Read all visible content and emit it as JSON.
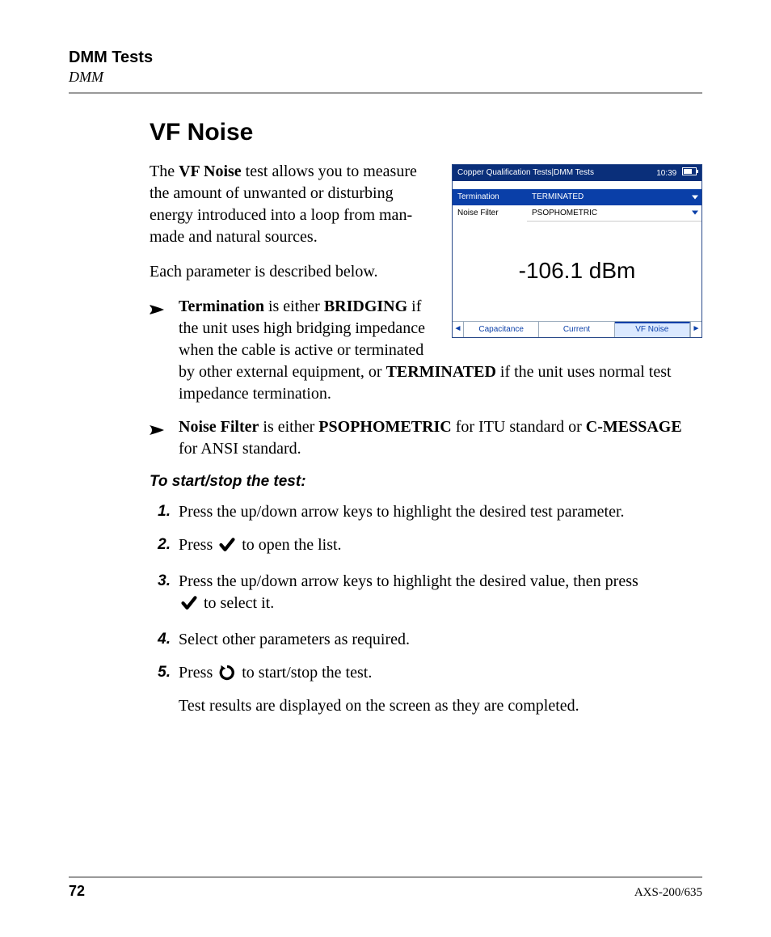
{
  "header": {
    "chapter": "DMM Tests",
    "section": "DMM"
  },
  "title": "VF Noise",
  "intro": {
    "p1_a": "The ",
    "p1_b": "VF Noise",
    "p1_c": " test allows you to measure the amount of unwanted or disturbing energy introduced into a loop from man-made and natural sources.",
    "p2": "Each parameter is described below."
  },
  "bullets": {
    "b1": {
      "t1": "Termination",
      "t2": " is either ",
      "t3": "BRIDGING",
      "t4": " if the unit uses high bridging impedance when the cable is active or terminated by other external equipment, or ",
      "t5": "TERMINATED",
      "t6": " if the unit uses normal test impedance termination."
    },
    "b2": {
      "t1": "Noise Filter",
      "t2": " is either ",
      "t3": "PSOPHOMETRIC",
      "t4": " for ITU standard or ",
      "t5": "C-MESSAGE",
      "t6": " for ANSI standard."
    }
  },
  "subhead": "To start/stop the test:",
  "steps": {
    "s1": {
      "n": "1.",
      "t": "Press the up/down arrow keys to highlight the desired test parameter."
    },
    "s2": {
      "n": "2.",
      "a": "Press ",
      "b": " to open the list."
    },
    "s3": {
      "n": "3.",
      "a": "Press the up/down arrow keys to highlight the desired value, then press ",
      "b": " to select it."
    },
    "s4": {
      "n": "4.",
      "t": "Select other parameters as required."
    },
    "s5": {
      "n": "5.",
      "a": "Press ",
      "b": " to start/stop the test.",
      "follow": "Test results are displayed on the screen as they are completed."
    }
  },
  "screenshot": {
    "title": "Copper Qualification Tests|DMM Tests",
    "time": "10:39",
    "rows": {
      "termination": {
        "label": "Termination",
        "value": "TERMINATED"
      },
      "filter": {
        "label": "Noise Filter",
        "value": "PSOPHOMETRIC"
      }
    },
    "reading": "-106.1 dBm",
    "tabs": {
      "t1": "Capacitance",
      "t2": "Current",
      "t3": "VF Noise"
    }
  },
  "footer": {
    "page": "72",
    "model": "AXS-200/635"
  }
}
